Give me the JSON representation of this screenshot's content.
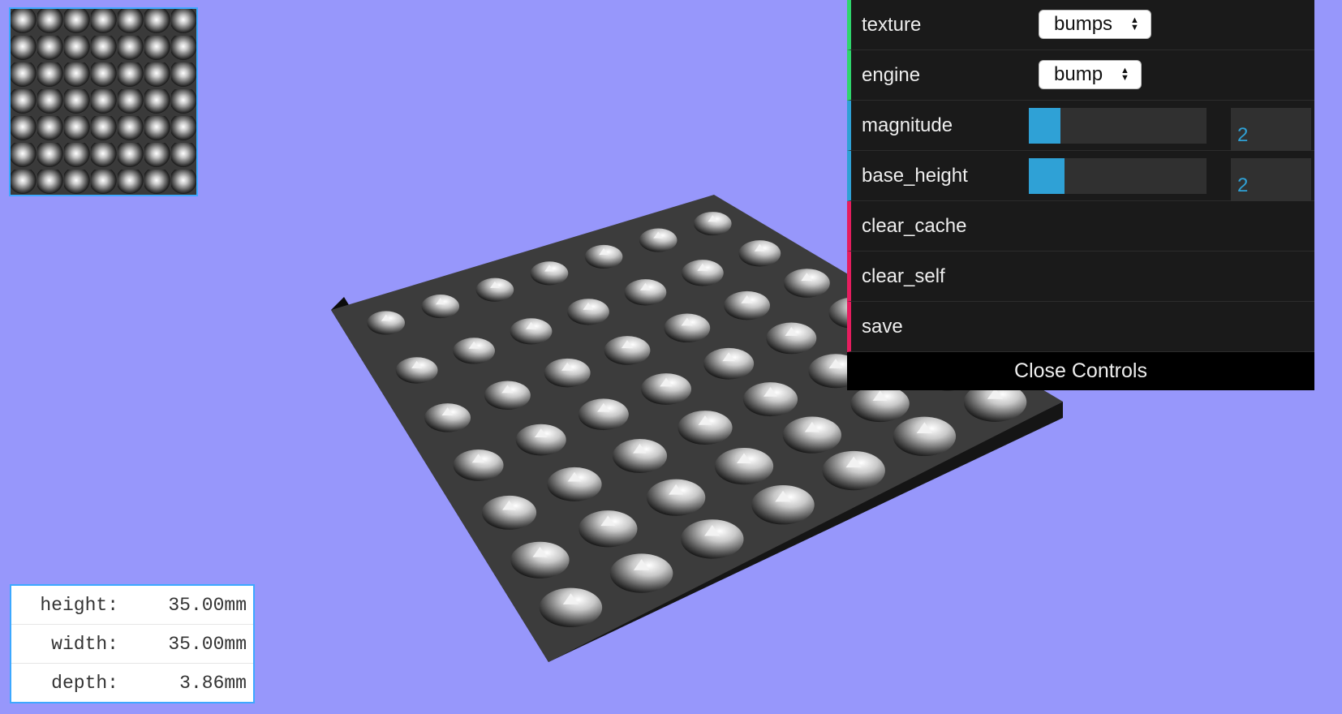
{
  "gui": {
    "texture": {
      "label": "texture",
      "value": "bumps"
    },
    "engine": {
      "label": "engine",
      "value": "bump"
    },
    "magnitude": {
      "label": "magnitude",
      "value": "2",
      "fill_fraction": 0.18
    },
    "base_height": {
      "label": "base_height",
      "value": "2",
      "fill_fraction": 0.2
    },
    "clear_cache": {
      "label": "clear_cache"
    },
    "clear_self": {
      "label": "clear_self"
    },
    "save": {
      "label": "save"
    },
    "close_label": "Close Controls"
  },
  "dimensions": [
    {
      "key": "height:",
      "value": "35.00mm"
    },
    {
      "key": "width:",
      "value": "35.00mm"
    },
    {
      "key": "depth:",
      "value": "3.86mm"
    }
  ],
  "colors": {
    "background": "#9797fb",
    "panel": "#1a1a1a",
    "accent_number": "#2fa1d6",
    "accent_combo": "#2fd66d",
    "accent_function": "#e61d5f"
  }
}
